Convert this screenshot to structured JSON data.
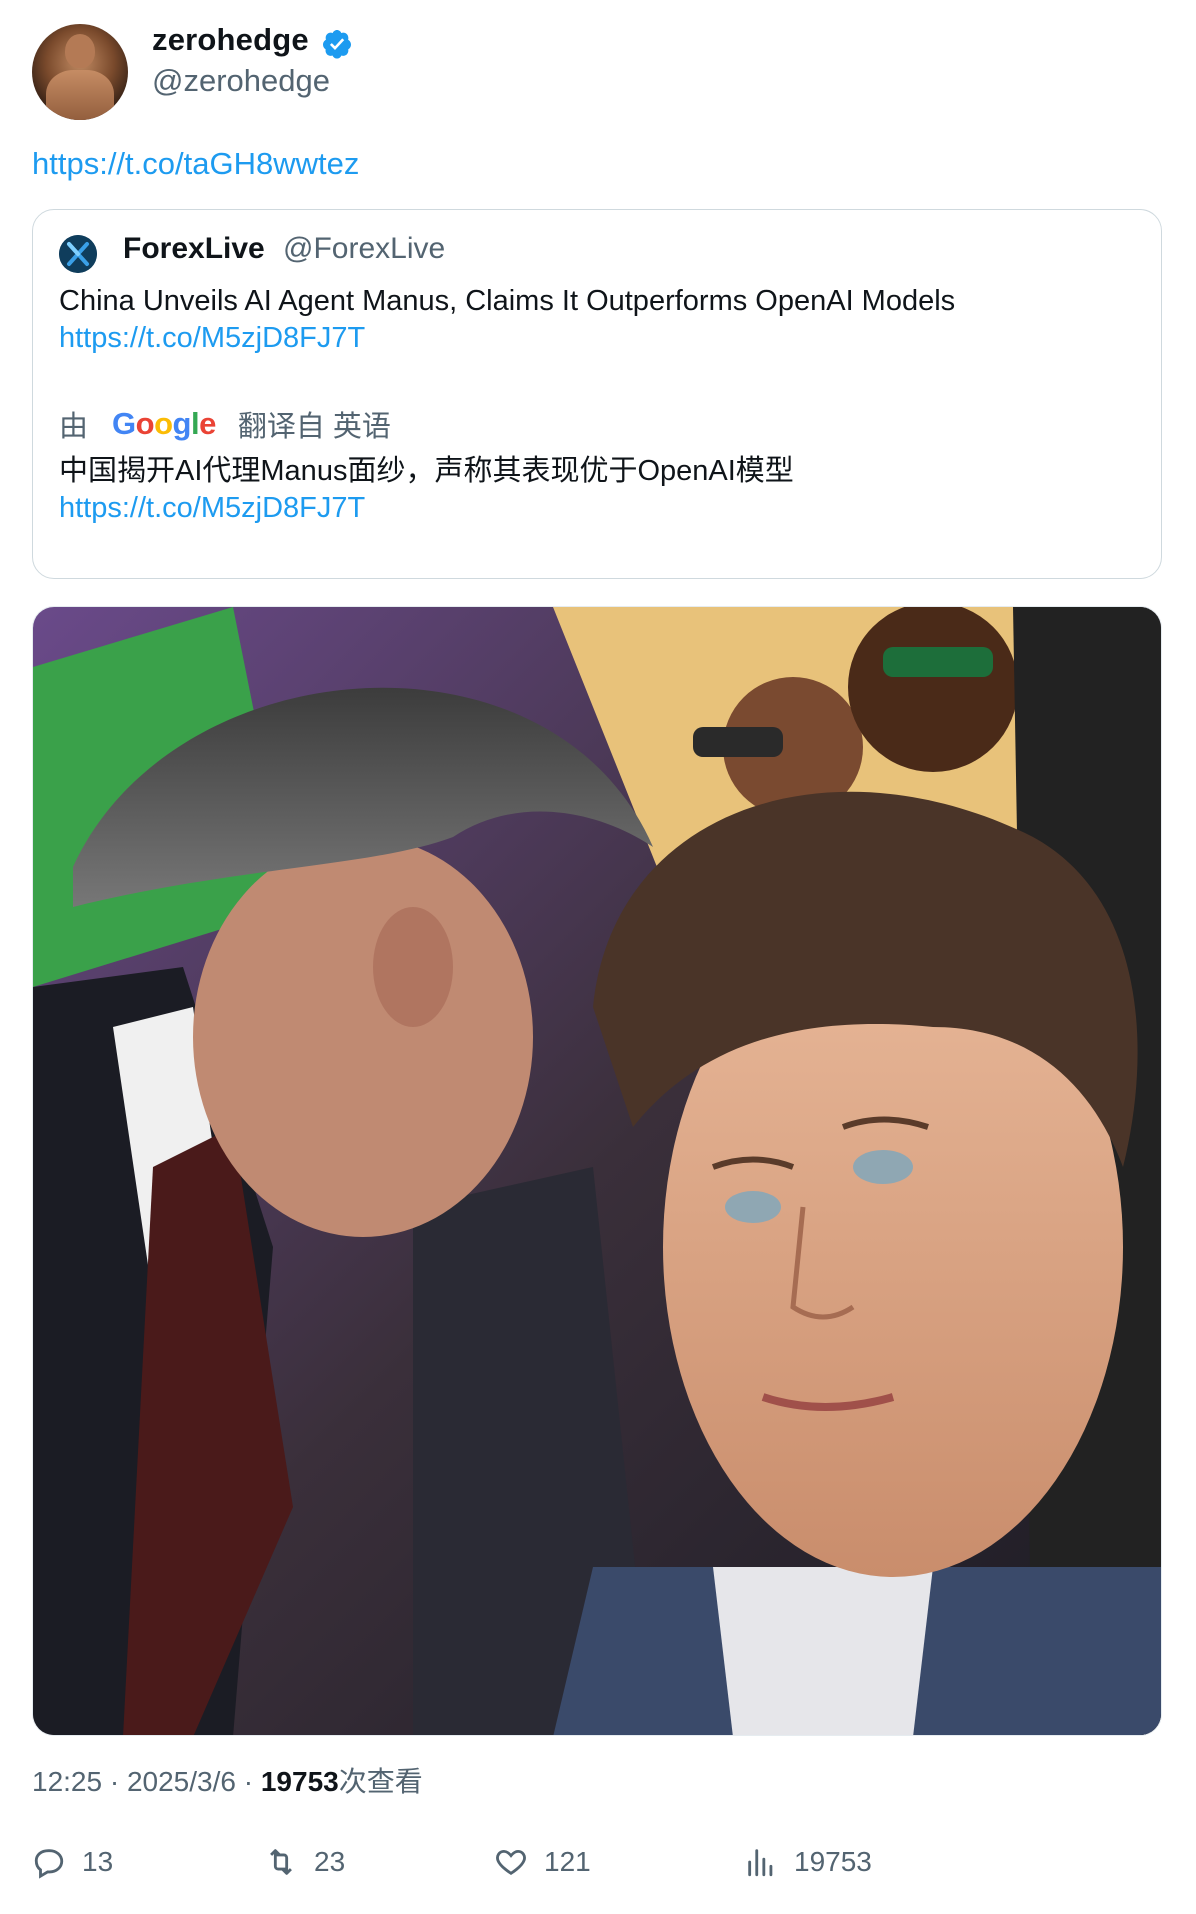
{
  "author": {
    "name": "zerohedge",
    "handle": "@zerohedge",
    "verified_color": "#1d9bf0",
    "avatar_icon": "avatar-photo"
  },
  "tweet": {
    "link": "https://t.co/taGH8wwtez"
  },
  "quoted_tweet": {
    "name": "ForexLive",
    "handle": "@ForexLive",
    "text": "China Unveils AI Agent Manus, Claims It Outperforms OpenAI Models",
    "link": "https://t.co/M5zjD8FJ7T",
    "translation": {
      "prefix": "由",
      "provider": "Google",
      "suffix": "翻译自 英语",
      "text": "中国揭开AI代理Manus面纱，声称其表现优于OpenAI模型",
      "link": "https://t.co/M5zjD8FJ7T"
    }
  },
  "meta": {
    "time": "12:25",
    "sep1": " · ",
    "date": "2025/3/6",
    "sep2": " · ",
    "views": "19753",
    "views_suffix": "次查看"
  },
  "actions": {
    "reply": "13",
    "retweet": "23",
    "like": "121",
    "views": "19753"
  }
}
